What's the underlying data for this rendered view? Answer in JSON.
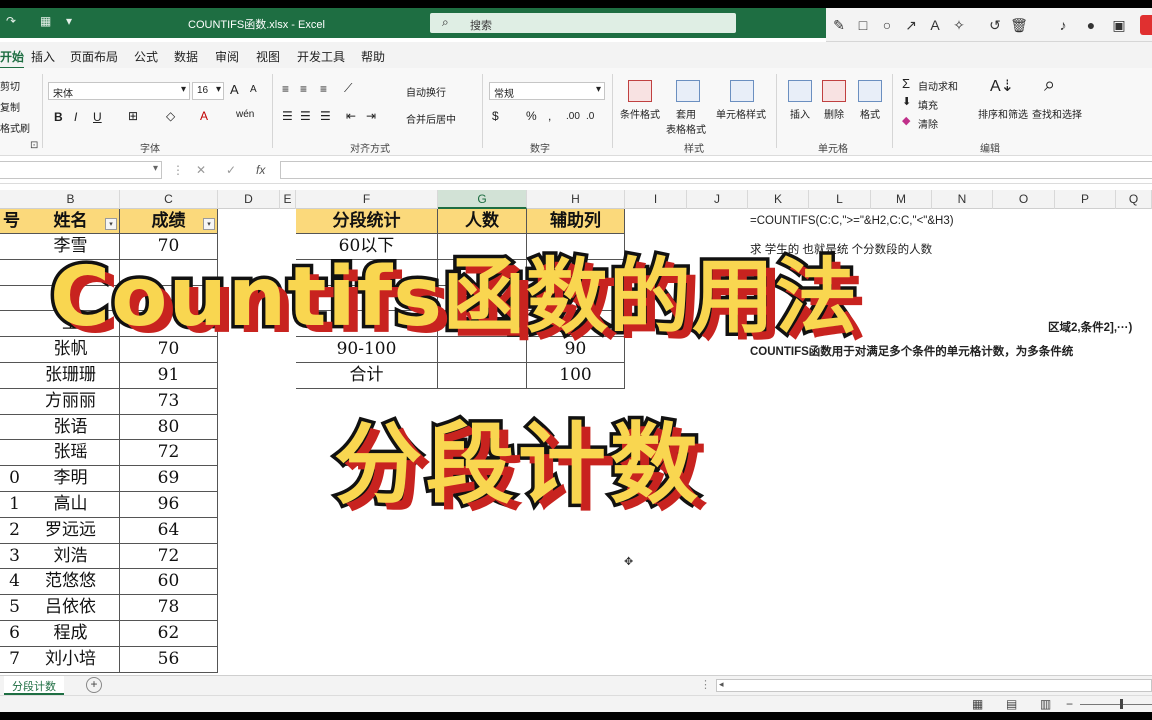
{
  "window": {
    "filename": "COUNTIFS函数.xlsx - Excel",
    "search_placeholder": "搜索"
  },
  "ribbon_tabs": [
    "开始",
    "插入",
    "页面布局",
    "公式",
    "数据",
    "审阅",
    "视图",
    "开发工具",
    "帮助"
  ],
  "clipboard": {
    "cut": "剪切",
    "copy": "复制",
    "format_painter": "格式刷"
  },
  "font": {
    "name": "宋体",
    "size": "16",
    "grow": "A",
    "shrink": "A",
    "bold": "B",
    "italic": "I",
    "underline": "U",
    "group_label": "字体"
  },
  "alignment": {
    "wrap": "自动换行",
    "merge": "合并后居中",
    "group_label": "对齐方式"
  },
  "number": {
    "format": "常规",
    "percent": "%",
    "group_label": "数字"
  },
  "styles": {
    "conditional": "条件格式",
    "table_format": "套用\n表格格式",
    "cell_styles": "单元格样式",
    "group_label": "样式"
  },
  "cells": {
    "insert": "插入",
    "delete": "删除",
    "format": "格式",
    "group_label": "单元格"
  },
  "editing": {
    "autosum": "自动求和",
    "fill": "填充",
    "clear": "清除",
    "sort_filter": "排序和筛选",
    "find_select": "查找和选择",
    "group_label": "编辑"
  },
  "formula_bar": {
    "fx": "fx"
  },
  "columns": [
    "B",
    "C",
    "D",
    "E",
    "F",
    "G",
    "H",
    "I",
    "J",
    "K",
    "L",
    "M",
    "N",
    "O",
    "P",
    "Q"
  ],
  "selected_column": "G",
  "table1": {
    "headers": [
      "号",
      "姓名",
      "成绩"
    ],
    "row_numbers": [
      "",
      "",
      "",
      "",
      "",
      "",
      "",
      "",
      "",
      "0",
      "1",
      "2",
      "3",
      "4",
      "5",
      "6",
      "7"
    ],
    "names": [
      "李雪",
      "",
      "",
      "王",
      "张帆",
      "张珊珊",
      "方丽丽",
      "张语",
      "张瑶",
      "李明",
      "高山",
      "罗远远",
      "刘浩",
      "范悠悠",
      "吕依依",
      "程成",
      "刘小培"
    ],
    "scores": [
      "70",
      "",
      "",
      "",
      "70",
      "91",
      "73",
      "80",
      "72",
      "69",
      "96",
      "64",
      "72",
      "60",
      "78",
      "62",
      "56"
    ]
  },
  "table2": {
    "headers": [
      "分段统计",
      "人数",
      "辅助列"
    ],
    "rows": [
      [
        "60以下",
        "",
        ""
      ],
      [
        "",
        "",
        ""
      ],
      [
        "",
        "",
        ""
      ],
      [
        "",
        "",
        ""
      ],
      [
        "90-100",
        "",
        "90"
      ],
      [
        "合计",
        "",
        "100"
      ]
    ]
  },
  "notes": {
    "formula": "=COUNTIFS(C:C,\">=\"&H2,C:C,\"<\"&H3)",
    "line2": "求     学生的                   也就是统      个分数段的人数",
    "line3": "区域2,条件2],···)",
    "line4": "COUNTIFS函数用于对满足多个条件的单元格计数，为多条件统"
  },
  "overlay": {
    "title": "Countifs函数的用法",
    "subtitle": "分段计数"
  },
  "sheet_tabs": [
    "分段计数"
  ],
  "colors": {
    "excel_green": "#1e6e42",
    "header_fill": "#fbd97b",
    "title_yellow": "#f9d650",
    "title_shadow": "#c8231f"
  }
}
